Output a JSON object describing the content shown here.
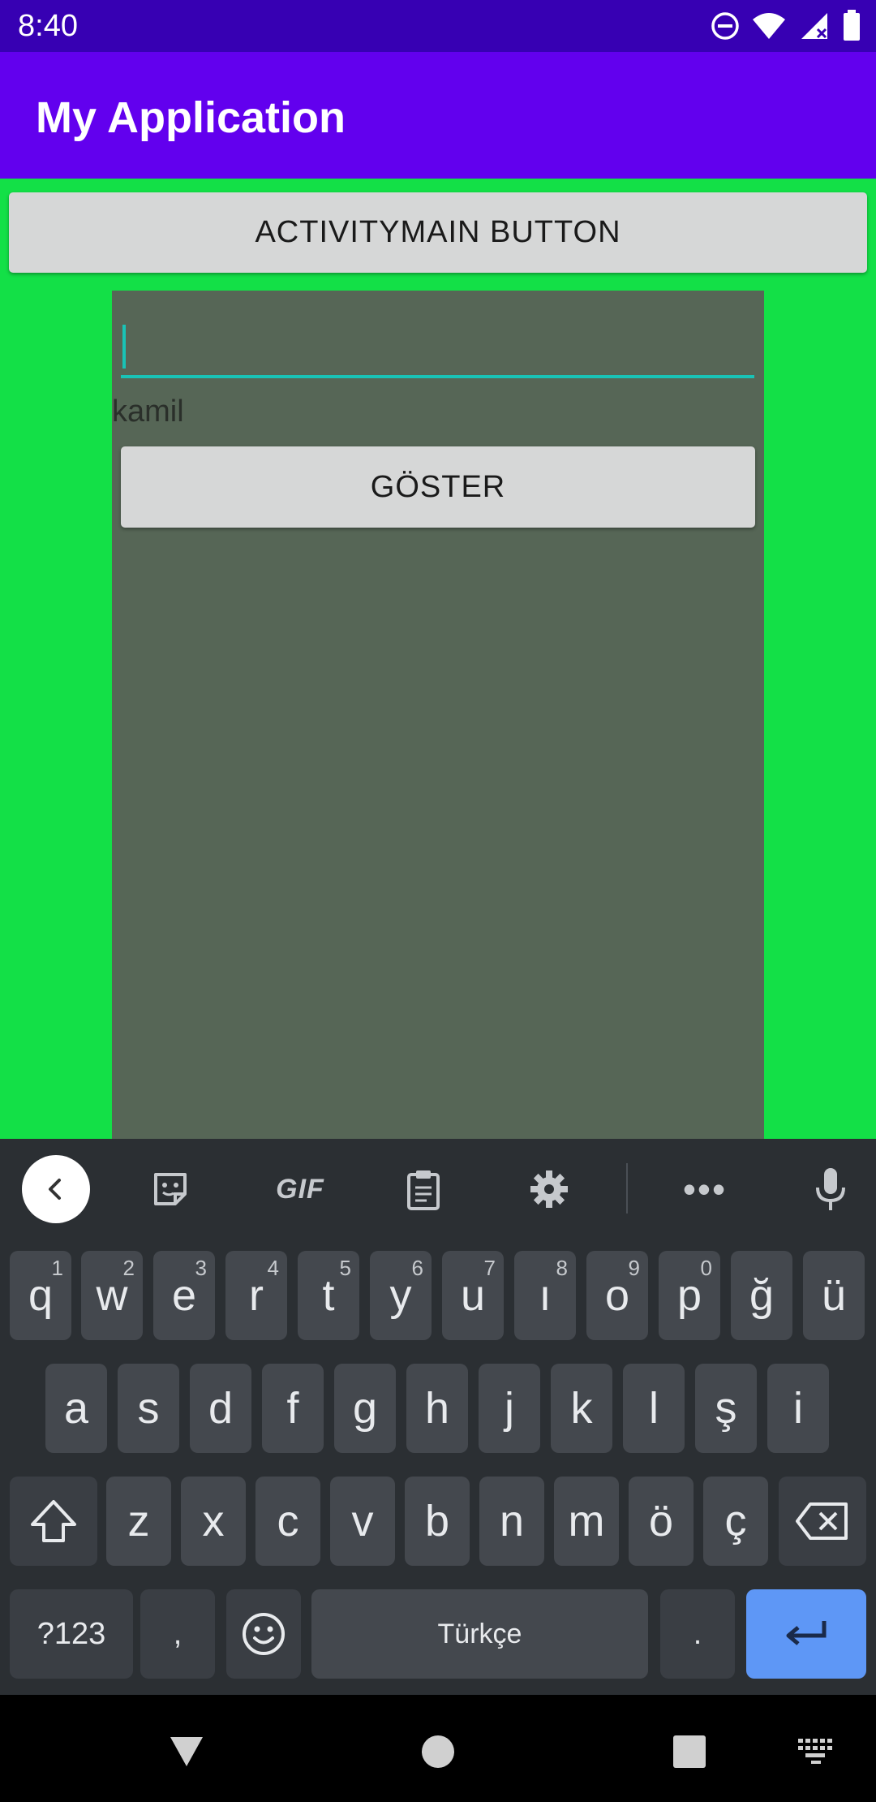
{
  "status_bar": {
    "time": "8:40",
    "icons": [
      "do-not-disturb-icon",
      "wifi-icon",
      "cellular-signal-icon",
      "battery-icon"
    ]
  },
  "app_bar": {
    "title": "My Application"
  },
  "content": {
    "background_color": "#13e047",
    "main_button_label": "ACTIVITYMAIN BUTTON",
    "panel": {
      "background_color": "#566656",
      "input_value": "",
      "text": "kamil",
      "button_label": "GÖSTER"
    }
  },
  "keyboard": {
    "toolbar_icons": [
      "back-icon",
      "sticker-icon",
      "gif-icon",
      "clipboard-icon",
      "settings-icon",
      "more-icon",
      "microphone-icon"
    ],
    "gif_label": "GIF",
    "more_label": "•••",
    "row1": [
      {
        "key": "q",
        "hint": "1"
      },
      {
        "key": "w",
        "hint": "2"
      },
      {
        "key": "e",
        "hint": "3"
      },
      {
        "key": "r",
        "hint": "4"
      },
      {
        "key": "t",
        "hint": "5"
      },
      {
        "key": "y",
        "hint": "6"
      },
      {
        "key": "u",
        "hint": "7"
      },
      {
        "key": "ı",
        "hint": "8"
      },
      {
        "key": "o",
        "hint": "9"
      },
      {
        "key": "p",
        "hint": "0"
      },
      {
        "key": "ğ",
        "hint": ""
      },
      {
        "key": "ü",
        "hint": ""
      }
    ],
    "row2": [
      "a",
      "s",
      "d",
      "f",
      "g",
      "h",
      "j",
      "k",
      "l",
      "ş",
      "i"
    ],
    "row3": [
      "z",
      "x",
      "c",
      "v",
      "b",
      "n",
      "m",
      "ö",
      "ç"
    ],
    "symbols_label": "?123",
    "comma_label": ",",
    "space_label": "Türkçe",
    "period_label": ".",
    "accent_color": "#5e97f6"
  },
  "nav_bar": {
    "icons": [
      "back-triangle-icon",
      "home-circle-icon",
      "recents-square-icon",
      "keyboard-switch-icon"
    ]
  }
}
